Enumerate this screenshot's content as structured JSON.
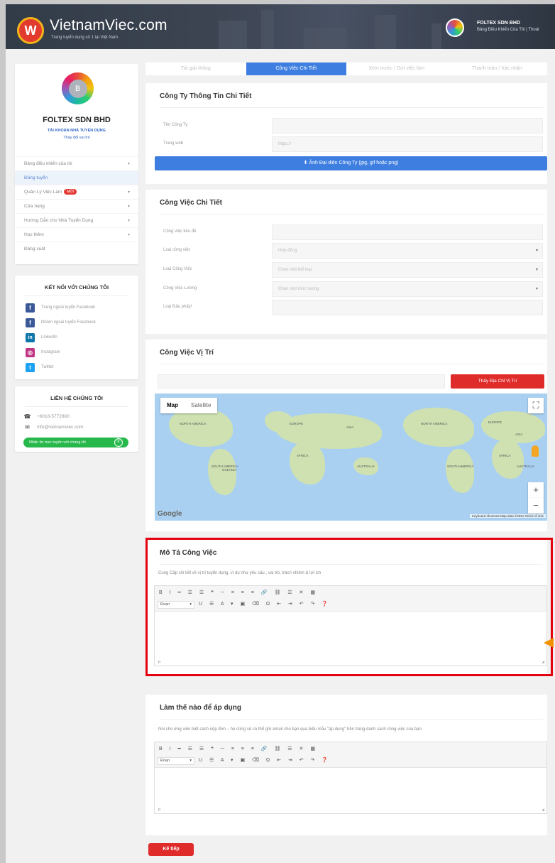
{
  "header": {
    "logo_letter": "W",
    "logo_text": "VietnamViec.com",
    "logo_tagline": "Trang tuyển dụng số 1 tại Việt Nam",
    "user_name": "FOLTEX SDN BHD",
    "user_links": "Bảng Điều Khiển Của Tôi  |  Thoát"
  },
  "profile": {
    "avatar_letter": "B",
    "name": "FOLTEX SDN BHD",
    "account_type": "TÀI KHOẢN NHÀ TUYỂN DỤNG",
    "change": "Thay đổi vai trò",
    "menu": [
      {
        "label": "Bảng điều khiển của tôi",
        "caret": "▾"
      },
      {
        "label": "Đăng tuyển",
        "caret": ""
      },
      {
        "label": "Quản Lý Việc Làm",
        "badge": "MỚI",
        "caret": "▾"
      },
      {
        "label": "Cửa hàng",
        "caret": "▾"
      },
      {
        "label": "Hướng Dẫn cho Nhà Tuyển Dụng",
        "caret": "▾"
      },
      {
        "label": "Học thêm",
        "caret": "▾"
      },
      {
        "label": "Đăng xuất",
        "caret": ""
      }
    ]
  },
  "connect": {
    "title": "KẾT NỐI VỚI CHÚNG TÔI",
    "items": [
      {
        "icon": "f",
        "label": "Trang ngoài tuyển Facebook"
      },
      {
        "icon": "f",
        "label": "Nhóm ngoài tuyển Facebook"
      },
      {
        "icon": "in",
        "label": "LinkedIn"
      },
      {
        "icon": "◎",
        "label": "Instagram"
      },
      {
        "icon": "t",
        "label": "Twitter"
      }
    ]
  },
  "contact": {
    "title": "LIÊN HỆ CHÚNG TÔI",
    "phone": "+6018-5772880",
    "email": "info@vietnamviec.com",
    "whatsapp": "Nhắn tin trực tuyến với chúng tôi"
  },
  "steps": [
    "Tài giải thông",
    "Công Việc Chi Tiết",
    "Xem trước / Gửi việc làm",
    "Thanh toán / Xác nhận"
  ],
  "company": {
    "title": "Công Ty Thông Tin Chi Tiết",
    "name_label": "Tên Công Ty",
    "website_label": "Trang web",
    "website_placeholder": "https://",
    "logo_button": "Ảnh Đại diện Công Ty (jpg, gif hoặc png)"
  },
  "job": {
    "title": "Công Việc Chi Tiết",
    "title_label": "Công việc tiêu đề",
    "type_label": "Loại công việc",
    "type_value": "Hợp đồng",
    "category_label": "Loại Công Việc",
    "category_placeholder": "Chọn một thể loại",
    "salary_label": "Công Việc Lương",
    "salary_placeholder": "Chọn một mức lương",
    "expiry_label": "Loại Đấu phấy!"
  },
  "location": {
    "title": "Công Việc Vị Trí",
    "find_button": "Thấy Địa Chỉ Vị Trí",
    "map_tab": "Map",
    "satellite_tab": "Satellite",
    "google": "Google",
    "footer": "Keyboard shortcuts   Map data ©2021   Terms of Use",
    "labels": [
      "NORTH AMERICA",
      "SOUTH AMERICA",
      "EUROPE",
      "AFRICA",
      "ASIA",
      "AUSTRALIA",
      "OCEANIA",
      "NORTH AMERICA",
      "SOUTH AMERICA",
      "EUROPE",
      "AFRICA",
      "ASIA",
      "AUSTRALIA"
    ]
  },
  "description": {
    "title": "Mô Tả Công Việc",
    "hint": "Cung Cấp chi tiết về vị trí tuyển dụng, ví dụ như yêu cầu , vai trò, trách nhiệm & lợi ích",
    "toolbar1": "B I ━ ☰ ☰ ❝ ─ ≡ ≡ ≡ 🔗 ⛓ ☰ ✕ ▦",
    "toolbar2": "U ☰ A ▾ ▣ ⌫ Ω ⇤ ⇥ ↶ ↷ ❓",
    "format": "Đoạn",
    "status": "p"
  },
  "apply": {
    "title": "Làm thế nào để áp dụng",
    "hint": "Nói cho ứng viên biết cách nộp đơn – họ cũng sẽ có thể gửi email cho bạn qua biểu mẫu \"áp dụng\" trên trang danh sách công việc của bạn.",
    "toolbar1": "B I ━ ☰ ☰ ❝ ─ ≡ ≡ ≡ 🔗 ⛓ ☰ ✕ ▦",
    "toolbar2": "U ☰ A ▾ ▣ ⌫ Ω ⇤ ⇥ ↶ ↷ ❓",
    "format": "Đoạn",
    "status": "p"
  },
  "next_button": "Kế tiếp",
  "colors": {
    "primary": "#3e7ee0",
    "danger": "#e02b2b",
    "highlight": "#e3000f",
    "arrow": "#f39200"
  }
}
